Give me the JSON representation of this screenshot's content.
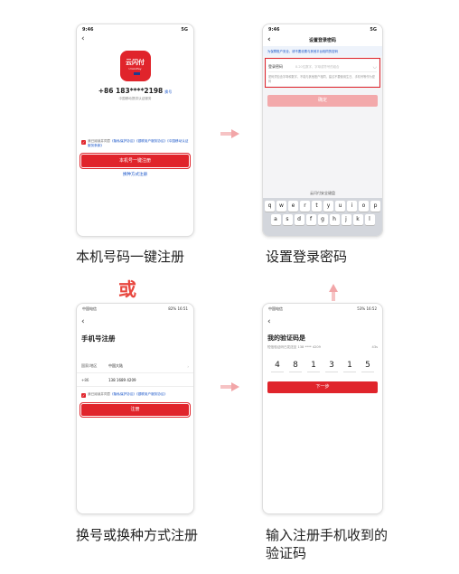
{
  "step1": {
    "time": "9:46",
    "signal": "5G",
    "logo": {
      "main": "云闪付",
      "sub": "UnionPay"
    },
    "phone_number": "+86 183****2198",
    "change_label": "换号",
    "carrier_note": "中国移动提供认证服务",
    "agreement": {
      "prefix": "我已阅读并同意",
      "link1": "《隐私保护协议》",
      "link2": "《银联用户服务协议》",
      "link3": "《中国移动认证服务条款》"
    },
    "register_button": "本机号一键注册",
    "alt_link": "换种方式注册",
    "caption": "本机号码一键注册"
  },
  "step2": {
    "time": "9:46",
    "signal": "5G",
    "title": "设置登录密码",
    "notice": "为保障账户安全，请不要设置与其他平台相同的密码",
    "field_label": "登录密码",
    "field_placeholder": "8-20位数字、字母或符号的组合",
    "hint": "密码须包含字母和数字，不能与其他账户相同，建议不要使用生日、手机号等作为密码",
    "confirm_button": "确定",
    "keyboard_title": "云闪付安全键盘",
    "keys_row1": [
      "q",
      "w",
      "e",
      "r",
      "t",
      "y",
      "u",
      "i",
      "o",
      "p"
    ],
    "keys_row2": [
      "a",
      "s",
      "d",
      "f",
      "g",
      "h",
      "j",
      "k",
      "l"
    ],
    "caption": "设置登录密码"
  },
  "or_label": "或",
  "step3": {
    "status_left": "中国电信",
    "status_right": "82% 16:51",
    "title": "手机号注册",
    "country_label": "国家/地区",
    "country_value": "中国大陆",
    "code_label": "+86",
    "phone_value": "138 1689 4209",
    "agreement": {
      "prefix": "我已阅读并同意",
      "link1": "《隐私保护协议》",
      "link2": "《银联用户服务协议》"
    },
    "register_button": "注册",
    "caption": "换号或换种方式注册"
  },
  "step4": {
    "status_left": "中国电信",
    "status_right": "53% 16:52",
    "title": "我的验证码是",
    "sent_note": "短信验证码已发送至 138 **** 4209",
    "countdown": "43s",
    "code": [
      "4",
      "8",
      "1",
      "3",
      "1",
      "5"
    ],
    "next_button": "下一步",
    "caption_line1": "输入注册手机收到的",
    "caption_line2": "验证码"
  },
  "colors": {
    "brand_red": "#e0242b",
    "link_blue": "#1a56c9",
    "arrow_pink": "#f2a6a8"
  }
}
